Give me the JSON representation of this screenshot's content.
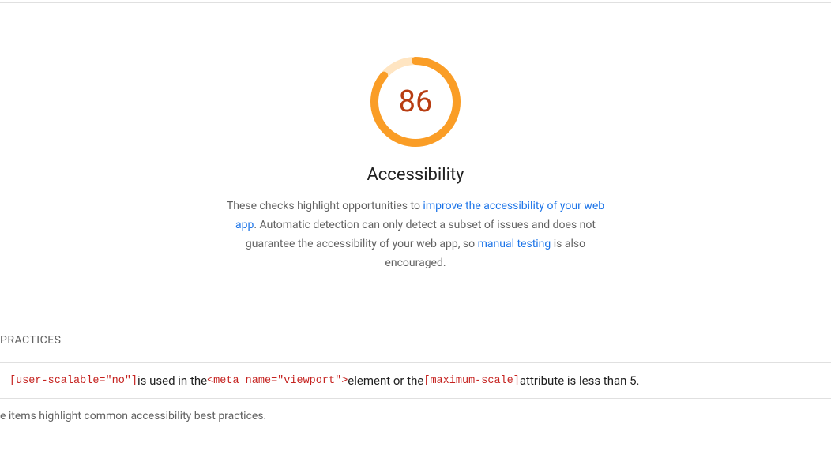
{
  "chart_data": {
    "type": "gauge",
    "value": 86,
    "max": 100,
    "title": "Accessibility",
    "color_fill": "#fa9d26",
    "color_bg": "#ffe5c2",
    "color_value": "#b83d12"
  },
  "score": {
    "value": "86",
    "category": "Accessibility"
  },
  "description": {
    "part1": "These checks highlight opportunities to ",
    "link1": "improve the accessibility of your web app",
    "part2": ". Automatic detection can only detect a subset of issues and does not guarantee the accessibility of your web app, so ",
    "link2": "manual testing",
    "part3": " is also encouraged."
  },
  "section": {
    "heading": " PRACTICES"
  },
  "audit": {
    "code1": "[user-scalable=\"no\"]",
    "text1": " is used in the ",
    "code2": "<meta name=\"viewport\">",
    "text2": " element or the ",
    "code3": "[maximum-scale]",
    "text3": " attribute is less than 5."
  },
  "footer": {
    "note": "e items highlight common accessibility best practices."
  }
}
